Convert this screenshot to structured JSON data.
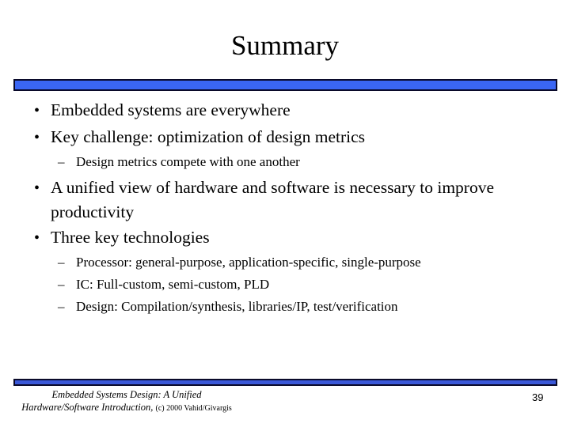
{
  "slide": {
    "title": "Summary",
    "accent_color": "#3a66f4",
    "bullets": [
      {
        "level": 1,
        "marker": "•",
        "text": "Embedded systems are everywhere"
      },
      {
        "level": 1,
        "marker": "•",
        "text": "Key challenge: optimization of design metrics"
      },
      {
        "level": 2,
        "marker": "–",
        "text": "Design metrics compete with one another"
      },
      {
        "level": 1,
        "marker": "•",
        "text": "A unified view of hardware and software is necessary to improve productivity"
      },
      {
        "level": 1,
        "marker": "•",
        "text": "Three key technologies"
      },
      {
        "level": 2,
        "marker": "–",
        "text": "Processor: general-purpose, application-specific, single-purpose"
      },
      {
        "level": 2,
        "marker": "–",
        "text": "IC: Full-custom, semi-custom, PLD"
      },
      {
        "level": 2,
        "marker": "–",
        "text": "Design: Compilation/synthesis, libraries/IP, test/verification"
      }
    ]
  },
  "footer": {
    "book_title_line1": "Embedded Systems Design: A Unified",
    "book_title_line2": "Hardware/Software Introduction,",
    "copyright": "(c) 2000 Vahid/Givargis",
    "page_number": "39"
  }
}
